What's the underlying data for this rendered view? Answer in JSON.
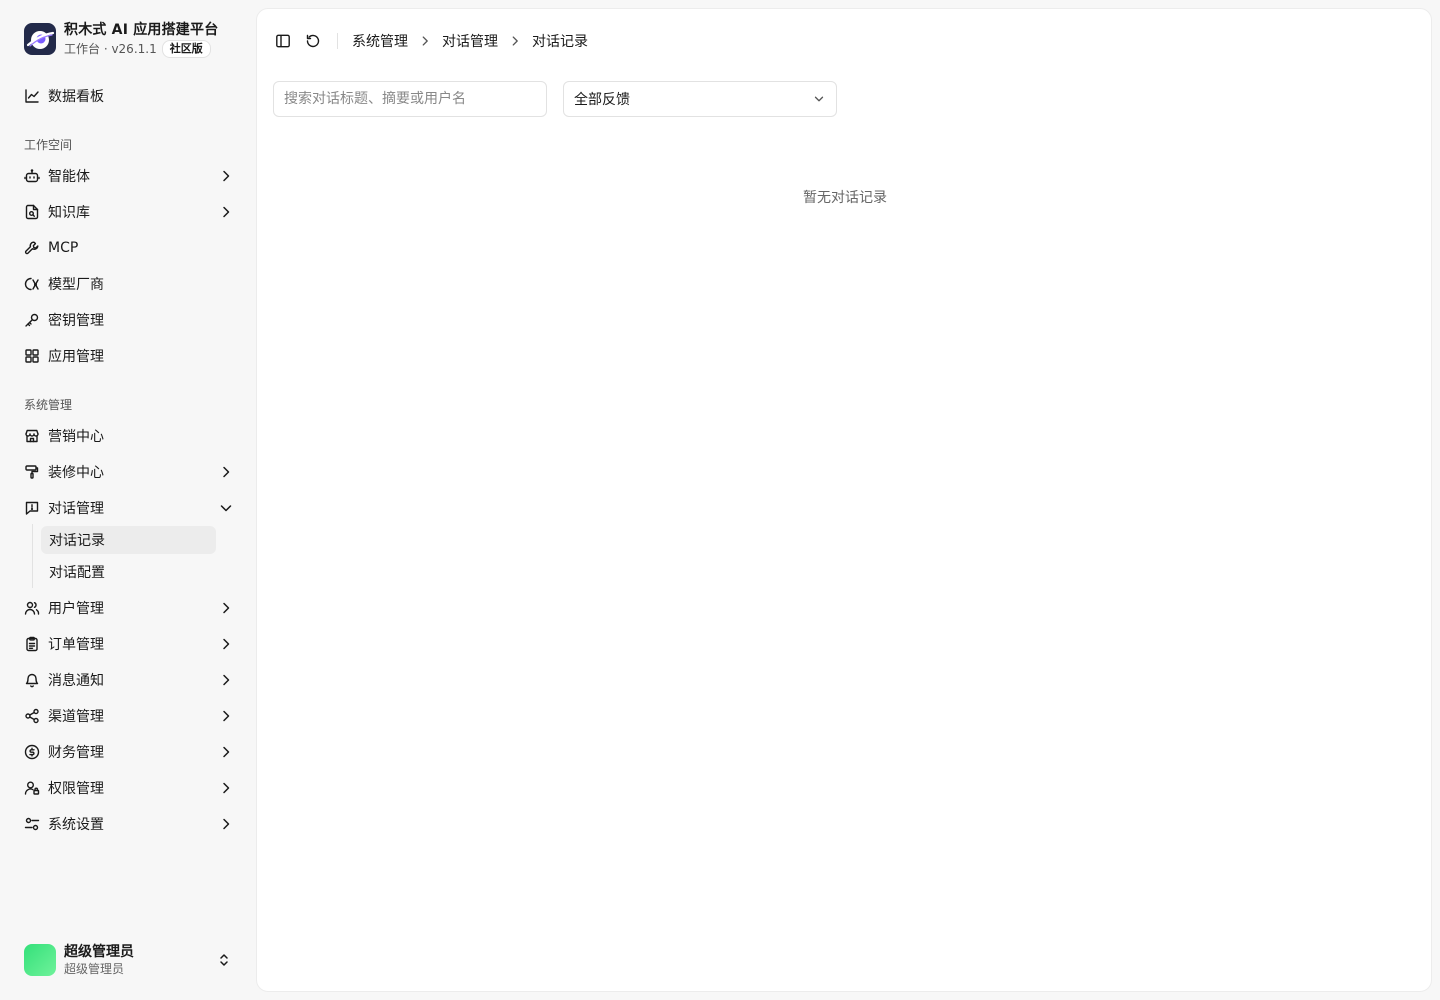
{
  "brand": {
    "title": "积木式 AI 应用搭建平台",
    "subtitle": "工作台 · v26.1.1",
    "edition_badge": "社区版"
  },
  "sidebar": {
    "dashboard": "数据看板",
    "workspace_heading": "工作空间",
    "workspace_items": [
      {
        "label": "智能体",
        "icon": "bot-icon",
        "expandable": true
      },
      {
        "label": "知识库",
        "icon": "file-search-icon",
        "expandable": true
      },
      {
        "label": "MCP",
        "icon": "wrench-icon",
        "expandable": false
      },
      {
        "label": "模型厂商",
        "icon": "model-icon",
        "expandable": false
      },
      {
        "label": "密钥管理",
        "icon": "key-icon",
        "expandable": false
      },
      {
        "label": "应用管理",
        "icon": "grid-icon",
        "expandable": false
      }
    ],
    "system_heading": "系统管理",
    "system_items": [
      {
        "label": "营销中心",
        "icon": "store-icon",
        "expandable": false
      },
      {
        "label": "装修中心",
        "icon": "paint-roller-icon",
        "expandable": true
      },
      {
        "label": "对话管理",
        "icon": "message-icon",
        "expandable": true,
        "expanded": true
      }
    ],
    "conversation_sub": [
      "对话记录",
      "对话配置"
    ],
    "conversation_sub_active": "对话记录",
    "system_items_after": [
      {
        "label": "用户管理",
        "icon": "users-icon"
      },
      {
        "label": "订单管理",
        "icon": "clipboard-icon"
      },
      {
        "label": "消息通知",
        "icon": "bell-icon"
      },
      {
        "label": "渠道管理",
        "icon": "share-icon"
      },
      {
        "label": "财务管理",
        "icon": "dollar-icon"
      },
      {
        "label": "权限管理",
        "icon": "user-lock-icon"
      },
      {
        "label": "系统设置",
        "icon": "settings-sliders-icon"
      }
    ]
  },
  "user": {
    "name": "超级管理员",
    "role": "超级管理员"
  },
  "breadcrumb": [
    "系统管理",
    "对话管理",
    "对话记录"
  ],
  "filters": {
    "search_placeholder": "搜索对话标题、摘要或用户名",
    "search_value": "",
    "feedback_selected": "全部反馈"
  },
  "empty_text": "暂无对话记录",
  "colors": {
    "background": "#f7f7f7",
    "panel": "#ffffff",
    "active_item": "#ececec",
    "avatar": "#34e07a",
    "logo_bg": "#232a4a"
  }
}
